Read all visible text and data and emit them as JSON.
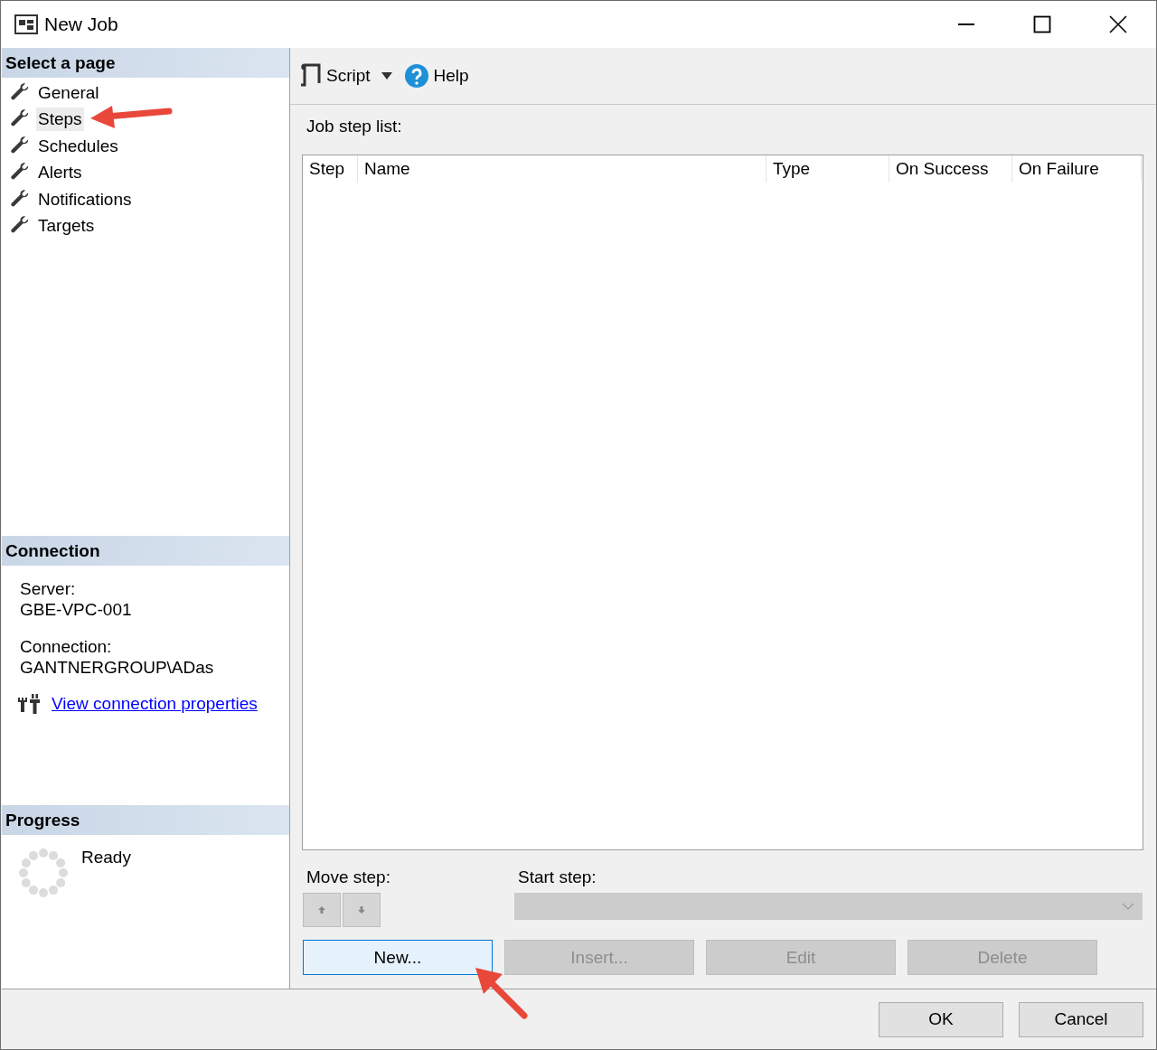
{
  "window": {
    "title": "New Job"
  },
  "sidebar": {
    "select_page": {
      "heading": "Select a page",
      "pages": [
        {
          "label": "General",
          "selected": false
        },
        {
          "label": "Steps",
          "selected": true
        },
        {
          "label": "Schedules",
          "selected": false
        },
        {
          "label": "Alerts",
          "selected": false
        },
        {
          "label": "Notifications",
          "selected": false
        },
        {
          "label": "Targets",
          "selected": false
        }
      ]
    },
    "connection": {
      "heading": "Connection",
      "server_label": "Server:",
      "server": "GBE-VPC-001",
      "connection_label": "Connection:",
      "connection": "GANTNERGROUP\\ADas",
      "link": "View connection properties"
    },
    "progress": {
      "heading": "Progress",
      "status": "Ready"
    }
  },
  "toolbar": {
    "script": "Script",
    "help": "Help"
  },
  "job_step_list": {
    "label": "Job step list:",
    "columns": [
      "Step",
      "Name",
      "Type",
      "On Success",
      "On Failure"
    ]
  },
  "move_step": {
    "label": "Move step:",
    "up_disabled": true,
    "down_disabled": true
  },
  "start_step": {
    "label": "Start step:",
    "disabled": true
  },
  "step_buttons": [
    {
      "label": "New...",
      "disabled": false,
      "focused": true
    },
    {
      "label": "Insert...",
      "disabled": true,
      "focused": false
    },
    {
      "label": "Edit",
      "disabled": true,
      "focused": false
    },
    {
      "label": "Delete",
      "disabled": true,
      "focused": false
    }
  ],
  "dialog_buttons": [
    "OK",
    "Cancel"
  ]
}
